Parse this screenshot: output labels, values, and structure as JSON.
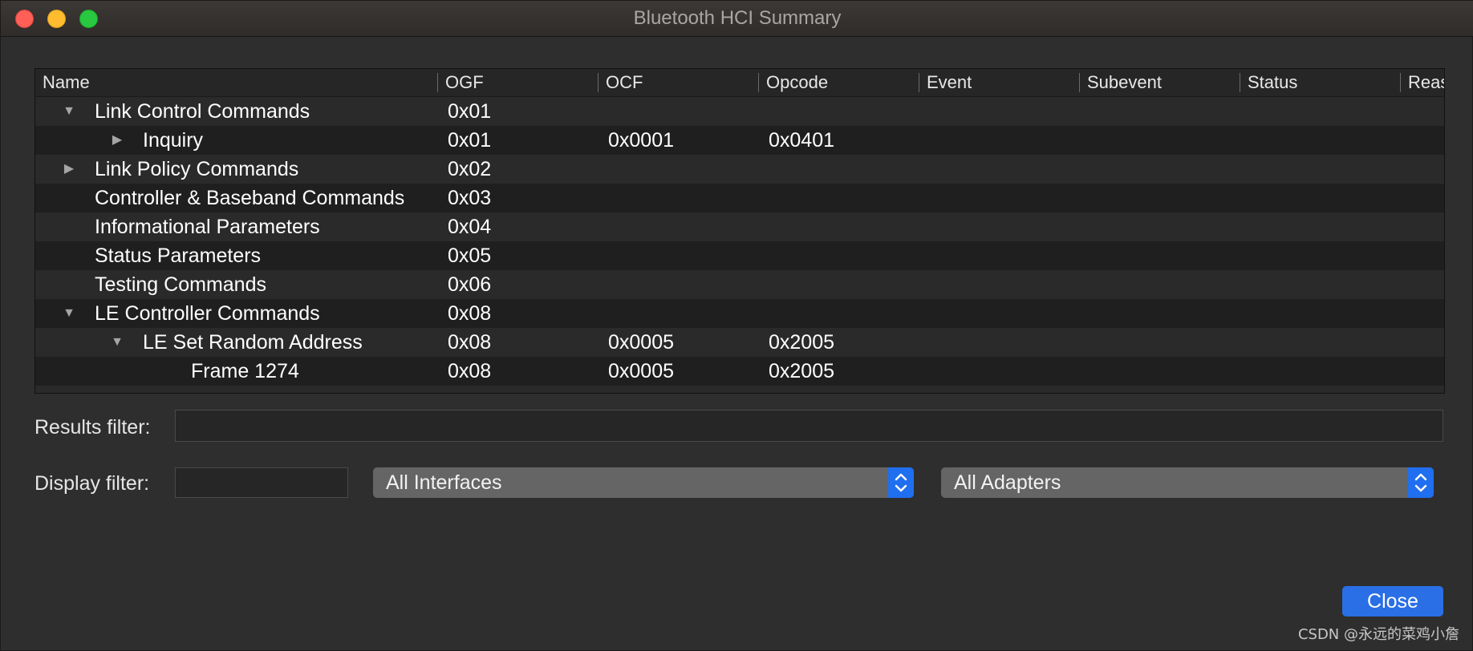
{
  "window": {
    "title": "Bluetooth HCI Summary"
  },
  "table": {
    "columns": [
      "Name",
      "OGF",
      "OCF",
      "Opcode",
      "Event",
      "Subevent",
      "Status",
      "Reas"
    ],
    "rows": [
      {
        "name": "Link Control Commands",
        "ogf": "0x01",
        "ocf": "",
        "opcode": "",
        "depth": 0,
        "toggle": "expanded"
      },
      {
        "name": "Inquiry",
        "ogf": "0x01",
        "ocf": "0x0001",
        "opcode": "0x0401",
        "depth": 1,
        "toggle": "collapsed"
      },
      {
        "name": "Link Policy Commands",
        "ogf": "0x02",
        "ocf": "",
        "opcode": "",
        "depth": 0,
        "toggle": "collapsed"
      },
      {
        "name": "Controller & Baseband Commands",
        "ogf": "0x03",
        "ocf": "",
        "opcode": "",
        "depth": 0,
        "toggle": "none"
      },
      {
        "name": "Informational Parameters",
        "ogf": "0x04",
        "ocf": "",
        "opcode": "",
        "depth": 0,
        "toggle": "none"
      },
      {
        "name": "Status Parameters",
        "ogf": "0x05",
        "ocf": "",
        "opcode": "",
        "depth": 0,
        "toggle": "none"
      },
      {
        "name": "Testing Commands",
        "ogf": "0x06",
        "ocf": "",
        "opcode": "",
        "depth": 0,
        "toggle": "none"
      },
      {
        "name": "LE Controller Commands",
        "ogf": "0x08",
        "ocf": "",
        "opcode": "",
        "depth": 0,
        "toggle": "expanded"
      },
      {
        "name": "LE Set Random Address",
        "ogf": "0x08",
        "ocf": "0x0005",
        "opcode": "0x2005",
        "depth": 1,
        "toggle": "expanded"
      },
      {
        "name": "Frame 1274",
        "ogf": "0x08",
        "ocf": "0x0005",
        "opcode": "0x2005",
        "depth": 2,
        "toggle": "none"
      }
    ]
  },
  "filters": {
    "results_label": "Results filter:",
    "results_value": "",
    "display_label": "Display filter:",
    "display_value": "",
    "interfaces_selected": "All Interfaces",
    "adapters_selected": "All Adapters"
  },
  "footer": {
    "close_label": "Close",
    "watermark": "CSDN @永远的菜鸡小詹"
  },
  "icons": {
    "expanded": "triangle-down-icon",
    "collapsed": "triangle-right-icon",
    "stepper": "up-down-chevron-icon"
  }
}
